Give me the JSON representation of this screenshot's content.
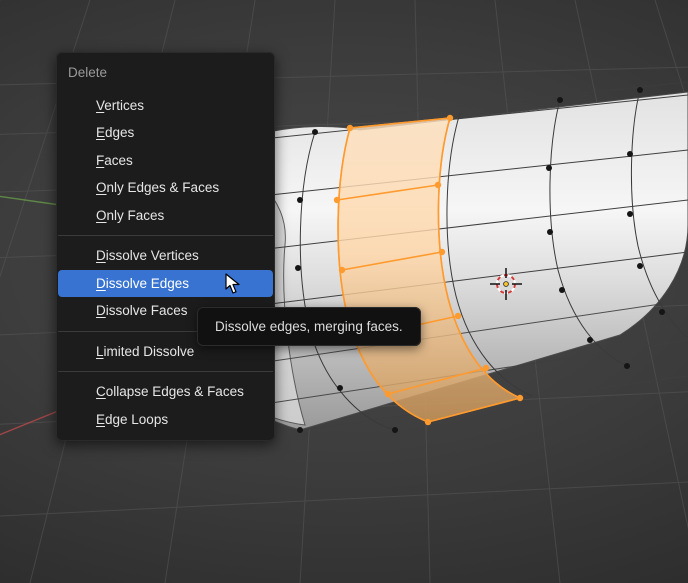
{
  "menu": {
    "title": "Delete",
    "groups": [
      {
        "items": [
          {
            "label": "Vertices",
            "name": "menu-item-vertices"
          },
          {
            "label": "Edges",
            "name": "menu-item-edges"
          },
          {
            "label": "Faces",
            "name": "menu-item-faces"
          },
          {
            "label": "Only Edges & Faces",
            "name": "menu-item-only-edges-faces"
          },
          {
            "label": "Only Faces",
            "name": "menu-item-only-faces"
          }
        ]
      },
      {
        "items": [
          {
            "label": "Dissolve Vertices",
            "name": "menu-item-dissolve-vertices"
          },
          {
            "label": "Dissolve Edges",
            "name": "menu-item-dissolve-edges",
            "highlighted": true
          },
          {
            "label": "Dissolve Faces",
            "name": "menu-item-dissolve-faces"
          }
        ]
      },
      {
        "items": [
          {
            "label": "Limited Dissolve",
            "name": "menu-item-limited-dissolve"
          }
        ]
      },
      {
        "items": [
          {
            "label": "Collapse Edges & Faces",
            "name": "menu-item-collapse-edges-faces"
          },
          {
            "label": "Edge Loops",
            "name": "menu-item-edge-loops"
          }
        ]
      }
    ]
  },
  "tooltip": {
    "text": "Dissolve edges, merging faces."
  }
}
